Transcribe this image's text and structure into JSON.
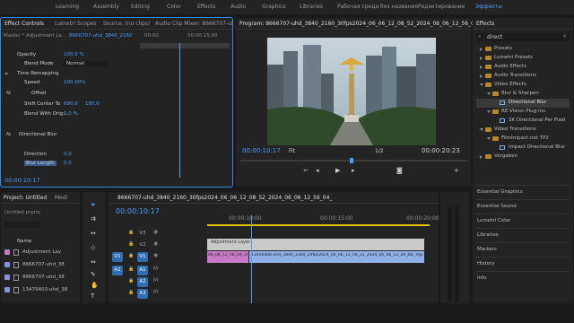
{
  "workspaces": [
    "Learning",
    "Assembly",
    "Editing",
    "Color",
    "Effects",
    "Audio",
    "Graphics",
    "Libraries",
    "Рабочая среда без названия",
    "Редактирование",
    "Эффекты"
  ],
  "effect_controls": {
    "tabs": [
      "Effect Controls",
      "Lumetri Scopes",
      "Source: (no clips)",
      "Audio Clip Mixer: 8666707-ul"
    ],
    "master": "Master * Adjustment La...",
    "clip": "8666707-uhd_3840_2160",
    "time_a": "00:00",
    "time_b": "00:00:15:00",
    "opacity_label": "Opacity",
    "opacity_value": "100,0 %",
    "blend_label": "Blend Mode",
    "blend_value": "Normal",
    "time_remap": "Time Remapping",
    "speed_label": "Speed",
    "speed_value": "100,00%",
    "offset_label": "Offset",
    "shift_label": "Shift Center To",
    "shift_x": "690,0",
    "shift_y": "180,0",
    "blend_orig_label": "Blend With Orig...",
    "blend_orig_value": "0,0 %",
    "dir_blur_label": "Directional Blur",
    "direction_label": "Direction",
    "direction_value": "0,0",
    "blur_len_label": "Blur Length",
    "blur_len_value": "0,0",
    "timecode": "00:00:10:17"
  },
  "program": {
    "title": "Program: 8666707-uhd_3840_2160_30fps2024_06_06_12_08_52_2024_06_06_12_56_04_",
    "timecode": "00:00:10:17",
    "fit": "Fit",
    "resolution": "1/2",
    "duration": "00:00:20:23"
  },
  "effects": {
    "title": "Effects",
    "search": "direct",
    "items": [
      {
        "label": "Presets",
        "indent": 0,
        "folder": true
      },
      {
        "label": "Lumetri Presets",
        "indent": 0,
        "folder": true
      },
      {
        "label": "Audio Effects",
        "indent": 0,
        "folder": true
      },
      {
        "label": "Audio Transitions",
        "indent": 0,
        "folder": true
      },
      {
        "label": "Video Effects",
        "indent": 0,
        "folder": true,
        "open": true
      },
      {
        "label": "Blur & Sharpen",
        "indent": 1,
        "folder": true,
        "open": true
      },
      {
        "label": "Directional Blur",
        "indent": 2,
        "folder": false,
        "selected": true
      },
      {
        "label": "RE:Vision Plug-ins",
        "indent": 1,
        "folder": true,
        "open": true
      },
      {
        "label": "SK Directional Per Pixel",
        "indent": 2,
        "folder": false
      },
      {
        "label": "Video Transitions",
        "indent": 0,
        "folder": true,
        "open": true
      },
      {
        "label": "FilmImpact.net TP2",
        "indent": 1,
        "folder": true,
        "open": true
      },
      {
        "label": "Impact Directional Blur",
        "indent": 2,
        "folder": false
      },
      {
        "label": "Vorgaben",
        "indent": 0,
        "folder": true
      }
    ],
    "panels": [
      "Essential Graphics",
      "Essential Sound",
      "Lumetri Color",
      "Libraries",
      "Markers",
      "History",
      "Info"
    ]
  },
  "project": {
    "tabs": [
      "Project: Untitled",
      "Medi"
    ],
    "file": "Untitled.prproj",
    "name_header": "Name",
    "items": [
      {
        "name": "Adjustment Lay",
        "color": "#c77ac6"
      },
      {
        "name": "8666707-uhd_38",
        "color": "#8a8fe0"
      },
      {
        "name": "8666707-uhd_38",
        "color": "#8a8fe0"
      },
      {
        "name": "13475403-uhd_38",
        "color": "#8a8fe0"
      }
    ]
  },
  "timeline": {
    "tab": "8666707-uhd_3840_2160_30fps2024_06_06_12_08_52_2024_06_06_12_56_04_",
    "timecode": "00:00:10:17",
    "ruler": [
      "00:00:10:00",
      "00:00:15:00",
      "00:00:20:00"
    ],
    "tracks": [
      "V3",
      "V2",
      "V1",
      "A1",
      "A2",
      "A3"
    ],
    "src_v": "V1",
    "src_a": "A1",
    "adj_clip": "Adjustment Layer",
    "clip_a": "06_06_12_56_04_.mp4",
    "clip_b": "13450408-uhd_3840_2160_24fps2024_06_06_12_56_31_2024_06_06_12_59_08_.mp4"
  },
  "colors": {
    "accent": "#2d8ceb",
    "playhead": "#4a9eff",
    "adj": "#c9c9c9",
    "clip_v": "#8fb0e8",
    "clip_pink": "#c77ac6"
  }
}
